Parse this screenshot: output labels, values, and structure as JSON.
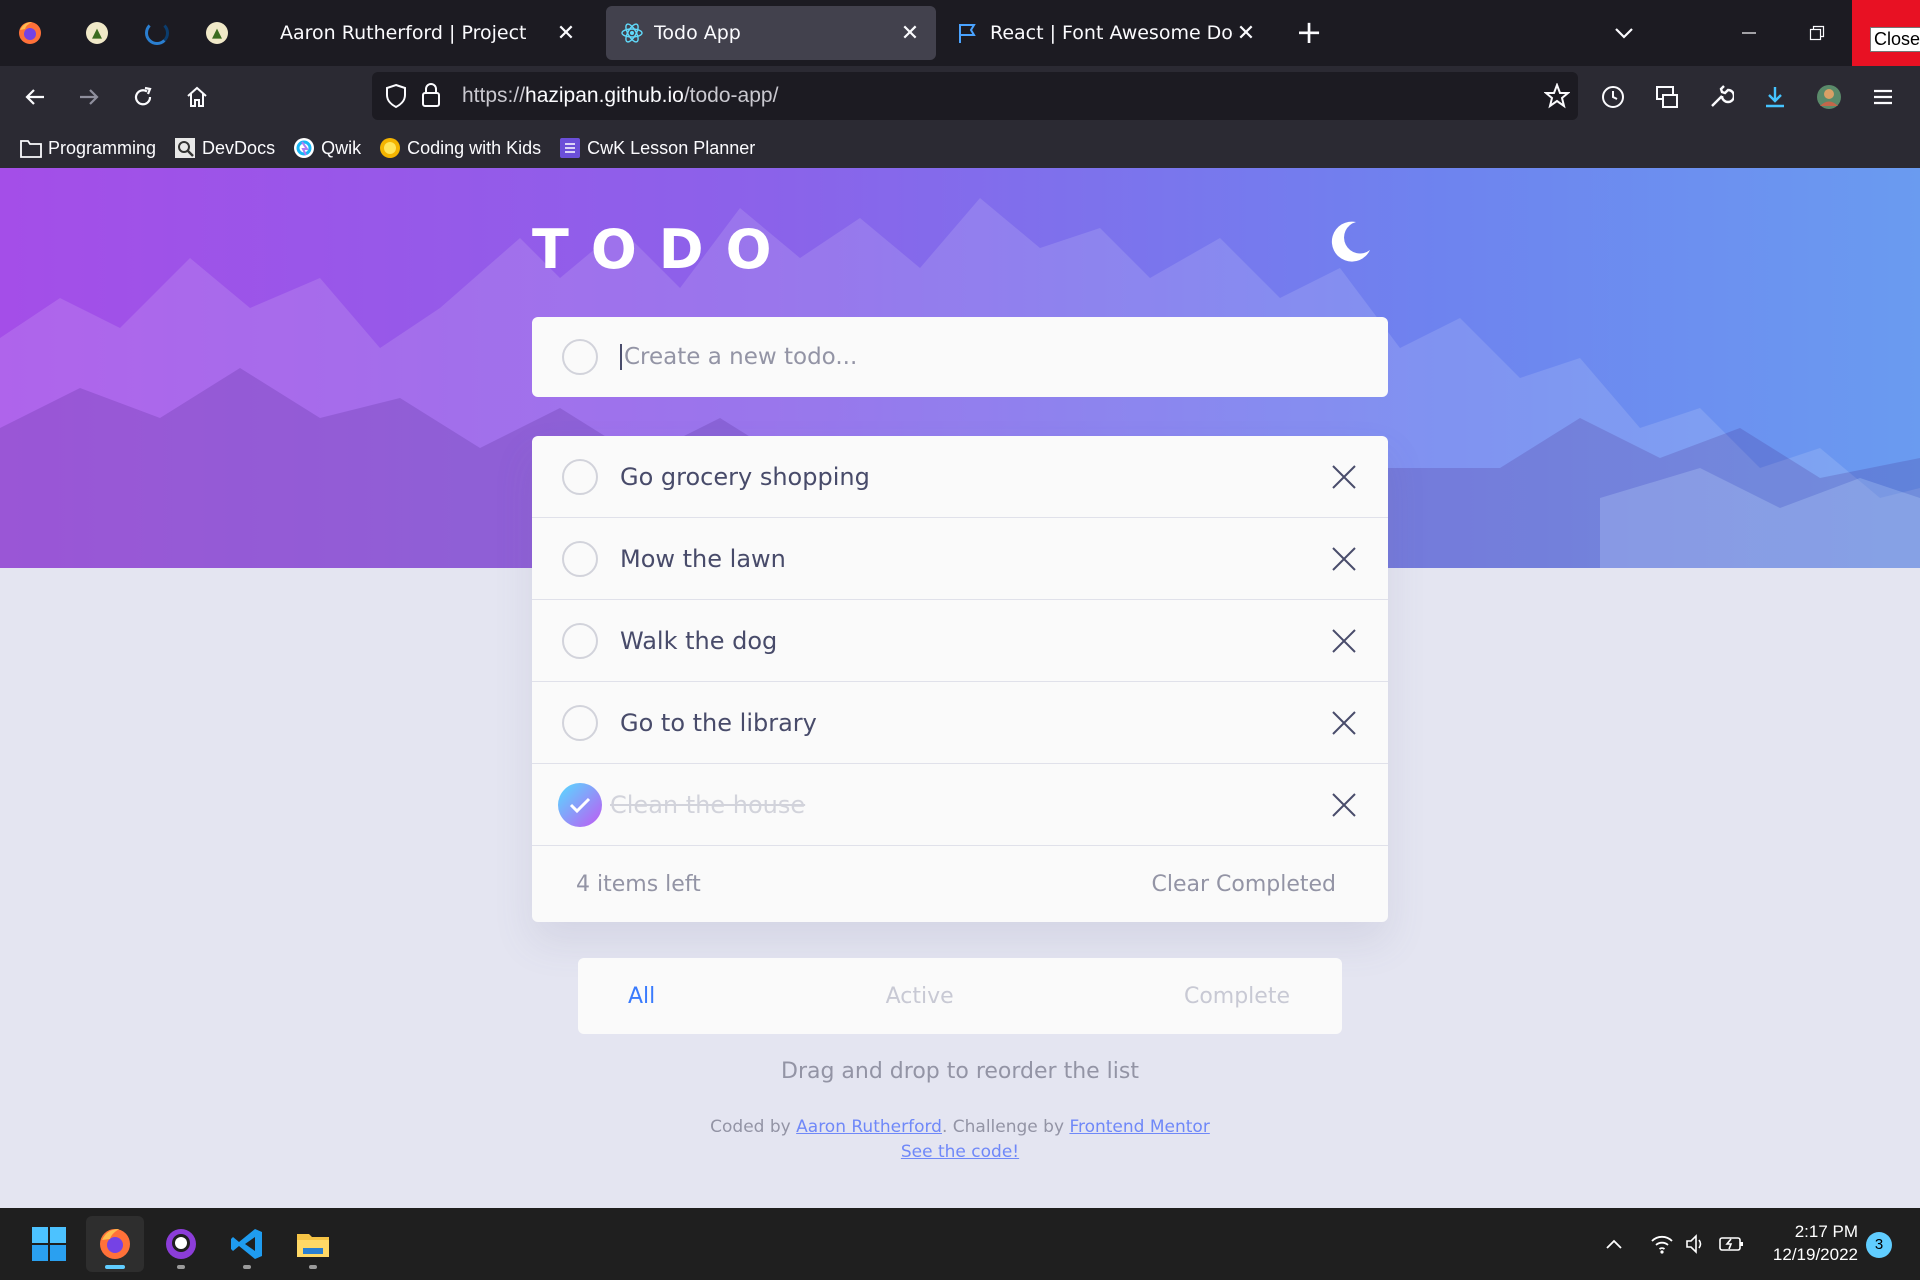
{
  "browser": {
    "tabs": [
      {
        "label": "Aaron Rutherford | Project",
        "active": false,
        "icon": "none"
      },
      {
        "label": "Todo App",
        "active": true,
        "icon": "react-icon"
      },
      {
        "label": "React | Font Awesome Docs",
        "active": false,
        "icon": "flag-icon"
      }
    ],
    "url": {
      "scheme": "https://",
      "host": "hazipan.github.io",
      "path": "/todo-app/"
    },
    "close_tooltip": "Close",
    "bookmarks": [
      {
        "label": "Programming",
        "icon": "folder-icon"
      },
      {
        "label": "DevDocs",
        "icon": "devdocs-icon"
      },
      {
        "label": "Qwik",
        "icon": "qwik-icon"
      },
      {
        "label": "Coding with Kids",
        "icon": "coding-with-kids-icon"
      },
      {
        "label": "CwK Lesson Planner",
        "icon": "lesson-planner-icon"
      }
    ]
  },
  "app": {
    "title": "TODO",
    "theme_icon": "moon-icon",
    "new_todo_placeholder": "Create a new todo...",
    "todos": [
      {
        "text": "Go grocery shopping",
        "completed": false
      },
      {
        "text": "Mow the lawn",
        "completed": false
      },
      {
        "text": "Walk the dog",
        "completed": false
      },
      {
        "text": "Go to the library",
        "completed": false
      },
      {
        "text": "Clean the house",
        "completed": true
      }
    ],
    "items_left": "4 items left",
    "clear_completed": "Clear Completed",
    "filters": {
      "all": "All",
      "active": "Active",
      "complete": "Complete",
      "selected": "All"
    },
    "hint": "Drag and drop to reorder the list",
    "credits": {
      "coded_by": "Coded by ",
      "author": "Aaron Rutherford",
      "challenge_by": ". Challenge by ",
      "mentor": "Frontend Mentor",
      "see_code": "See the code!"
    },
    "colors": {
      "accent": "#3a7bfd",
      "check_gradient_start": "#55ddff",
      "check_gradient_end": "#c058f3",
      "hero_start": "#a44ee8",
      "hero_end": "#6a9bf0"
    }
  },
  "taskbar": {
    "apps": [
      "start-icon",
      "firefox-icon",
      "github-desktop-icon",
      "vscode-icon",
      "file-explorer-icon"
    ],
    "time": "2:17 PM",
    "date": "12/19/2022",
    "notifications": "3"
  }
}
